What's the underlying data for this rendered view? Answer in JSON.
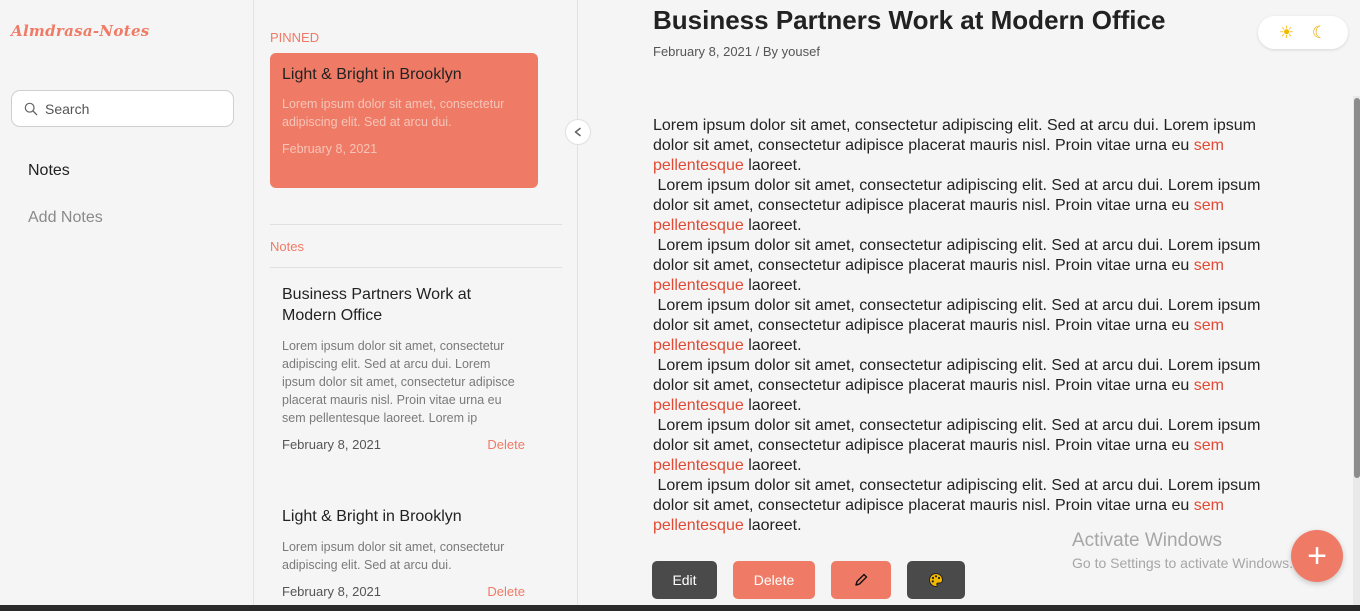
{
  "app": {
    "logo": "Almdrasa-Notes"
  },
  "sidebar": {
    "search_placeholder": "Search",
    "nav": [
      {
        "label": "Notes"
      },
      {
        "label": "Add Notes"
      }
    ]
  },
  "list": {
    "pinned_label": "PINNED",
    "pinned": {
      "title": "Light & Bright in Brooklyn",
      "excerpt": "Lorem ipsum dolor sit amet, consectetur adipiscing elit. Sed at arcu dui.",
      "date": "February 8, 2021"
    },
    "notes_label": "Notes",
    "notes": [
      {
        "title": "Business Partners Work at Modern Office",
        "excerpt": "Lorem ipsum dolor sit amet, consectetur adipiscing elit. Sed at arcu dui. Lorem ipsum dolor sit amet, consectetur adipisce placerat mauris nisl. Proin vitae urna eu sem pellentesque laoreet.  Lorem ip",
        "date": "February 8, 2021",
        "delete_label": "Delete"
      },
      {
        "title": "Light & Bright in Brooklyn",
        "excerpt": "Lorem ipsum dolor sit amet, consectetur adipiscing elit. Sed at arcu dui.",
        "date": "February 8, 2021",
        "delete_label": "Delete"
      }
    ]
  },
  "main": {
    "title": "Business Partners Work at Modern Office",
    "meta": "February 8, 2021 / By yousef",
    "paragraph": {
      "text_before": "Lorem ipsum dolor sit amet, consectetur adipiscing elit. Sed at arcu dui. Lorem ipsum dolor sit amet, consectetur adipisce placerat mauris nisl. Proin vitae urna eu ",
      "highlight": "sem pellentesque",
      "text_after": " laoreet."
    },
    "paragraph_count": 7,
    "actions": {
      "edit": "Edit",
      "delete": "Delete"
    }
  },
  "theme": {
    "light_icon": "sun-icon",
    "dark_icon": "moon-icon"
  },
  "watermark": {
    "line1": "Activate Windows",
    "line2": "Go to Settings to activate Windows."
  },
  "fab": {
    "label": "+"
  },
  "colors": {
    "accent": "#ef7b66",
    "highlight": "#e04a34",
    "dark_button": "#4a4a4a"
  }
}
